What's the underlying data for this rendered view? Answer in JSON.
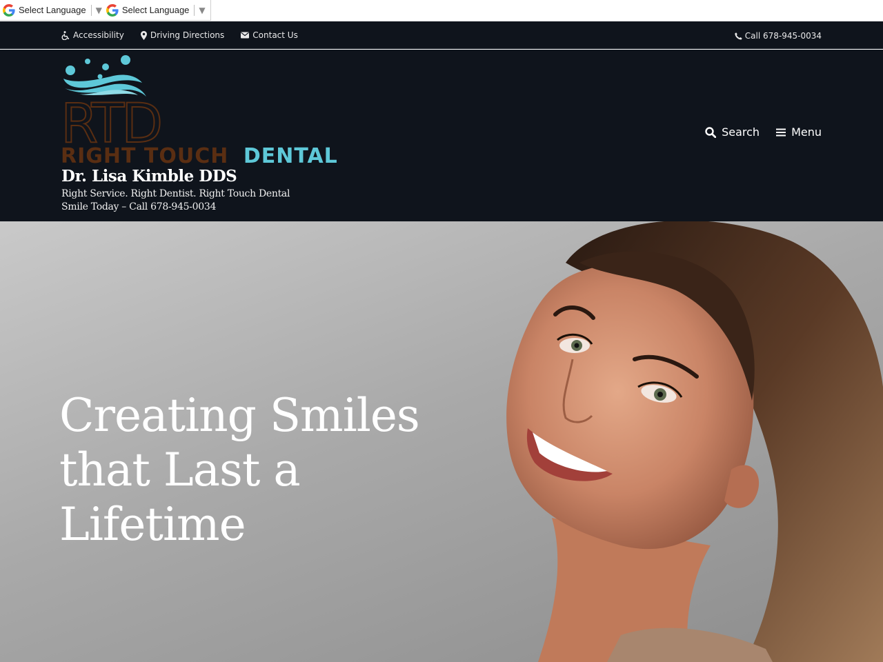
{
  "translate": {
    "widgets": [
      {
        "label": "Select Language"
      },
      {
        "label": "Select Language"
      }
    ]
  },
  "utility_bar": {
    "links": [
      {
        "label": "Accessibility",
        "icon": "wheelchair-icon"
      },
      {
        "label": "Driving Directions",
        "icon": "map-marker-icon"
      },
      {
        "label": "Contact Us",
        "icon": "envelope-icon"
      }
    ],
    "call_label": "Call 678-945-0034",
    "call_icon": "phone-icon"
  },
  "header": {
    "logo": {
      "monogram": "RTD",
      "wordmark_part1": "RIGHT TOUCH",
      "wordmark_part2": "DENTAL",
      "colors": {
        "brown": "#5a2e12",
        "teal": "#5ec8d8"
      }
    },
    "doctor_name": "Dr. Lisa Kimble DDS",
    "tagline": "Right Service. Right Dentist. Right Touch Dental",
    "call_line": "Smile Today – Call 678-945-0034",
    "nav": {
      "search_label": "Search",
      "menu_label": "Menu"
    }
  },
  "hero": {
    "title_lines": [
      "Creating Smiles",
      "that Last a",
      "Lifetime"
    ]
  },
  "colors": {
    "header_bg": "#0f141c",
    "text_light": "#ffffff"
  }
}
